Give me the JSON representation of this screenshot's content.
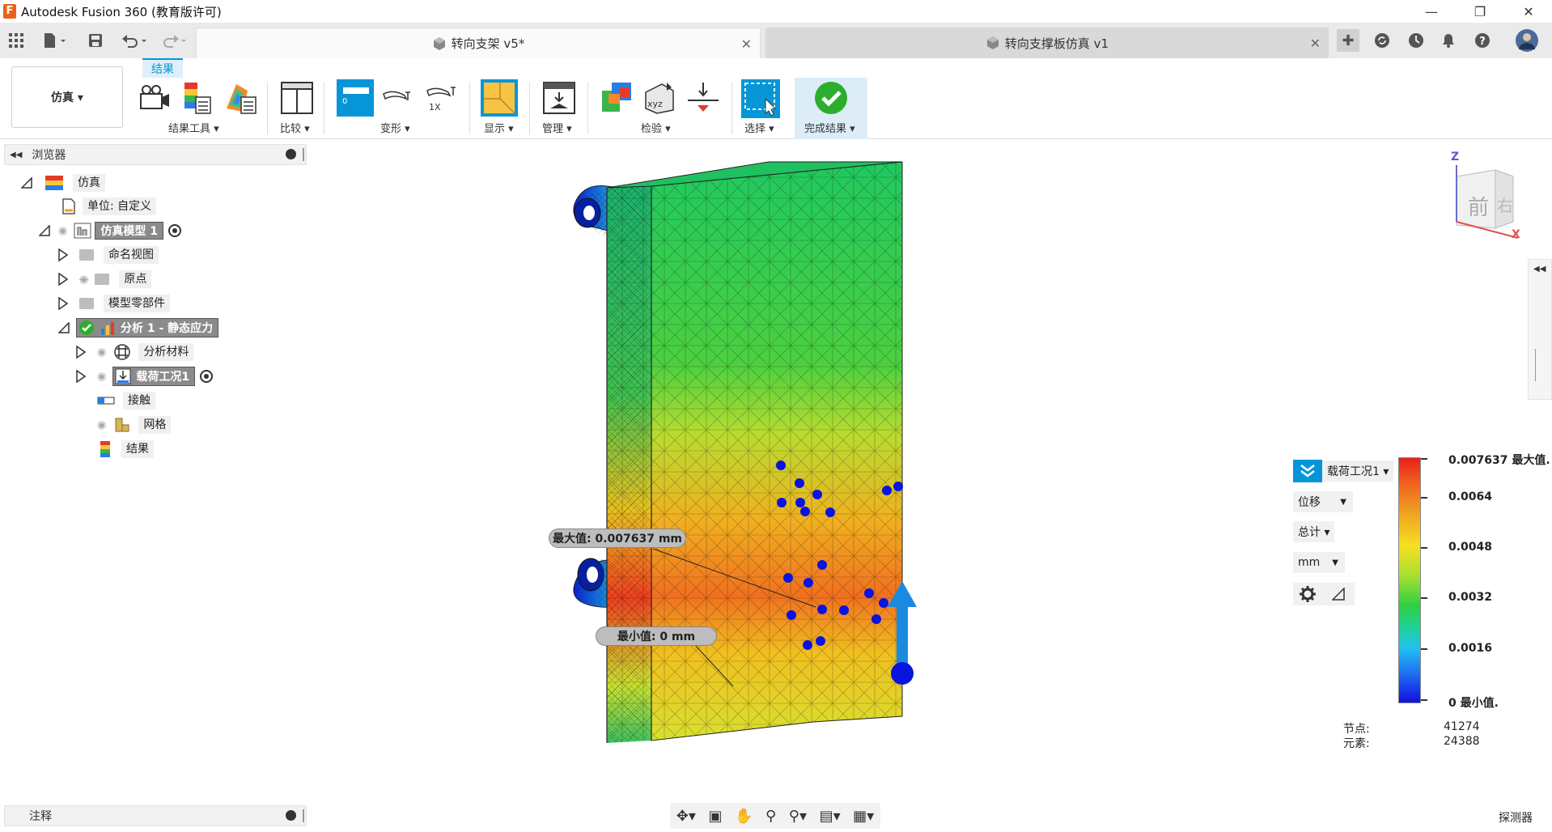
{
  "window": {
    "title": "Autodesk Fusion 360 (教育版许可)",
    "logo": "F"
  },
  "tabs": [
    {
      "label": "转向支架 v5*",
      "active": true
    },
    {
      "label": "转向支撑板仿真 v1",
      "active": false
    }
  ],
  "toolbar": {
    "workspace": "仿真 ▾",
    "active_tab": "结果",
    "groups": {
      "result_tools": "结果工具 ▾",
      "compare": "比较 ▾",
      "deform": "变形 ▾",
      "display": "显示 ▾",
      "manage": "管理 ▾",
      "inspect": "检验 ▾",
      "select": "选择 ▾",
      "finish": "完成结果 ▾"
    },
    "deform_value": "0",
    "deform_scale": "1X",
    "xyz": "xyz"
  },
  "browser": {
    "title": "浏览器",
    "items": [
      {
        "label": "仿真"
      },
      {
        "label": "单位: 自定义"
      },
      {
        "label": "仿真模型 1"
      },
      {
        "label": "命名视图"
      },
      {
        "label": "原点"
      },
      {
        "label": "模型零部件"
      },
      {
        "label": "分析 1 - 静态应力"
      },
      {
        "label": "分析材料"
      },
      {
        "label": "载荷工况1"
      },
      {
        "label": "接触"
      },
      {
        "label": "网格"
      },
      {
        "label": "结果"
      }
    ]
  },
  "comments": {
    "label": "注释"
  },
  "viewcube": {
    "face_front": "前",
    "face_right": "右",
    "axis_z": "Z",
    "axis_x": "X"
  },
  "right_panel": {
    "label": "探测器"
  },
  "callouts": {
    "max": "最大值: 0.007637 mm",
    "min": "最小值: 0 mm"
  },
  "results": {
    "load_case": "载荷工况1 ▾",
    "type": "位移",
    "component": "总计 ▾",
    "unit": "mm",
    "legend": {
      "max": "0.007637 最大值.",
      "ticks": [
        "0.0064",
        "0.0048",
        "0.0032",
        "0.0016"
      ],
      "min": "0 最小值."
    },
    "nodes_label": "节点:",
    "nodes_value": "41274",
    "elements_label": "元素:",
    "elements_value": "24388"
  },
  "colors": {
    "accent": "#0696d7",
    "success": "#2cae2c",
    "selected": "#8b8b8b"
  }
}
